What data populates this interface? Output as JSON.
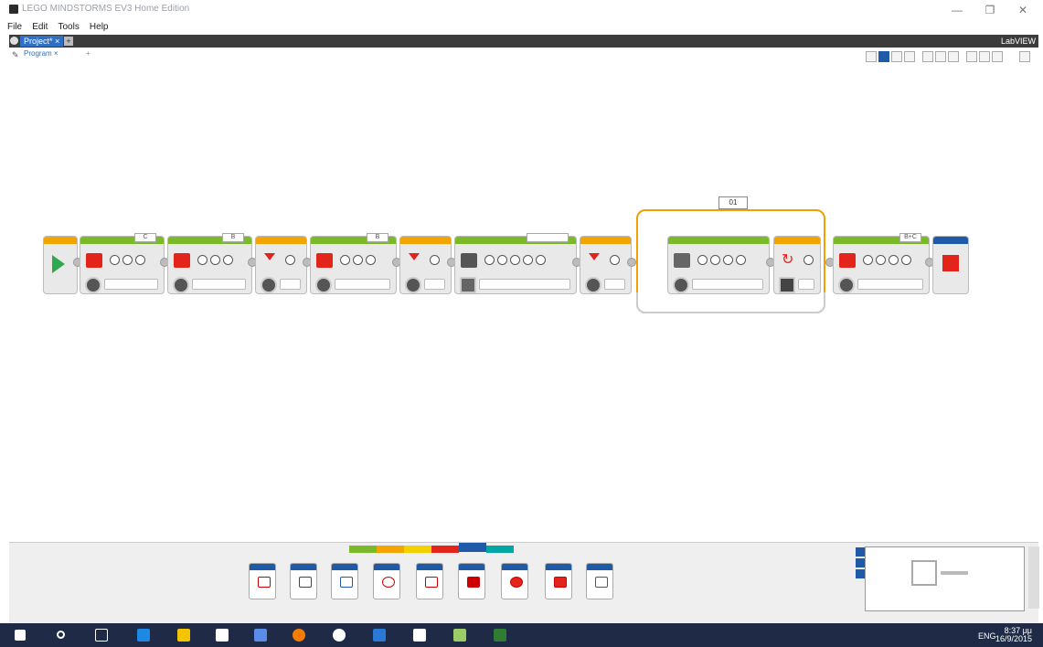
{
  "window": {
    "title": "LEGO MINDSTORMS EV3 Home Edition",
    "minimize": "—",
    "maximize": "❐",
    "close": "✕"
  },
  "menu": [
    "File",
    "Edit",
    "Tools",
    "Help"
  ],
  "project_tab": {
    "label": "Project*",
    "close": "×",
    "add": "+",
    "right_label": "LabVIEW"
  },
  "program_tab": {
    "label": "Program",
    "close": "×",
    "add": "+"
  },
  "loop": {
    "name": "01"
  },
  "colors": {
    "action": "#7ab927",
    "flow": "#f2a400",
    "sensor": "#f5d000",
    "data": "#e2241a",
    "advanced": "#1e5aa8",
    "myblocks": "#00a6a6",
    "start": "#2fa84f",
    "stop": "#e2241a"
  },
  "palette_categories": [
    "action",
    "flow",
    "sensor",
    "data",
    "advanced",
    "myblocks"
  ],
  "palette_blocks": [
    "file-access-icon",
    "data-logging-icon",
    "messaging-icon",
    "bluetooth-icon",
    "keep-awake-icon",
    "raw-sensor-icon",
    "unregulated-motor-icon",
    "invert-motor-icon",
    "stop-program-icon"
  ],
  "taskbar": {
    "time": "8:37 μμ",
    "date": "16/9/2015",
    "lang": "ENG"
  }
}
